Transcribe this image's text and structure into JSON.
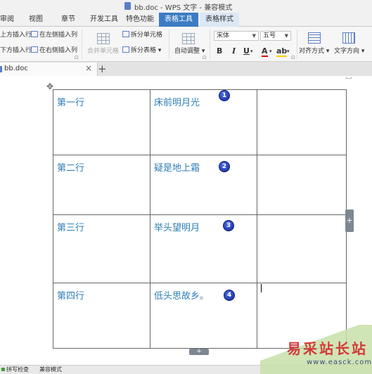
{
  "window": {
    "title": "bb.doc - WPS 文字 - 兼容模式"
  },
  "tabs": [
    {
      "label": "审阅"
    },
    {
      "label": "视图"
    },
    {
      "label": "章节"
    },
    {
      "label": "开发工具"
    },
    {
      "label": "特色功能"
    },
    {
      "label": "表格工具"
    },
    {
      "label": "表格样式"
    }
  ],
  "ribbon": {
    "insert_above": "上方插入行",
    "insert_below": "下方插入行",
    "insert_left": "在左侧插入列",
    "insert_right": "在右侧插入列",
    "merge_cells": "合并单元格",
    "split_cells": "拆分单元格",
    "split_table": "拆分表格",
    "autofit": "自动调整",
    "font_name": "宋体",
    "font_size": "五号",
    "bold": "B",
    "italic": "I",
    "underline": "U",
    "font_color": "A",
    "align": "对齐方式",
    "text_direction": "文字方向"
  },
  "doc_tab": {
    "name": "bb.doc",
    "close": "×",
    "new": "+"
  },
  "table": {
    "rows": [
      {
        "label": "第一行",
        "text": "床前明月光",
        "badge": "1"
      },
      {
        "label": "第二行",
        "text": "疑是地上霜",
        "badge": "2"
      },
      {
        "label": "第三行",
        "text": "举头望明月",
        "badge": "3"
      },
      {
        "label": "第四行",
        "text": "低头思故乡。",
        "badge": "4"
      }
    ]
  },
  "statusbar": {
    "spell_check": "拼写检查",
    "mode": "兼容模式"
  },
  "watermark": {
    "text": "易采站长站",
    "url": "www.easck.com"
  },
  "colors": {
    "accent_tab": "#3c7cc4",
    "table_text": "#2e7fb5",
    "badge": "#1427a0"
  }
}
